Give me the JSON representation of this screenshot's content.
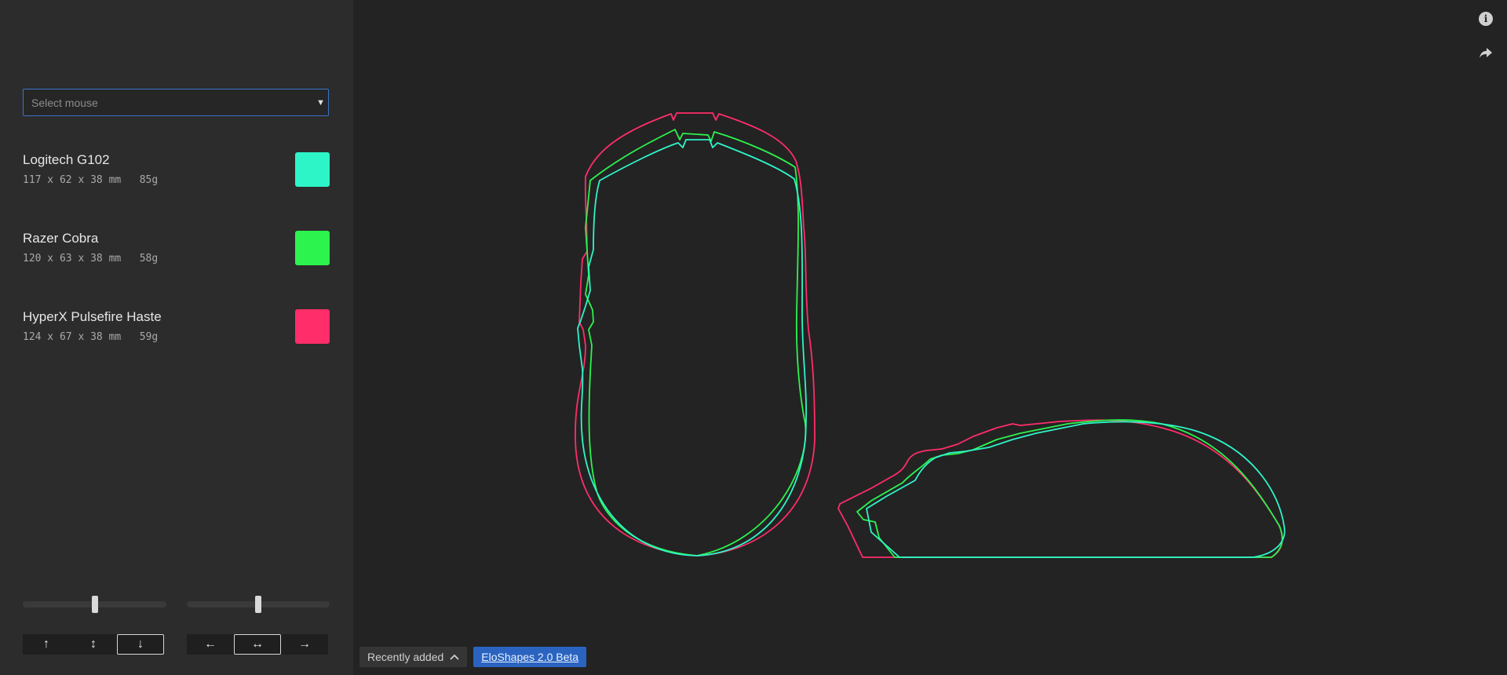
{
  "sidebar": {
    "select": {
      "placeholder": "Select mouse"
    },
    "mice": [
      {
        "name": "Logitech G102",
        "specs": "117 x 62 x 38 mm   85g",
        "color": "#2ef5c8"
      },
      {
        "name": "Razer Cobra",
        "specs": "120 x 63 x 38 mm   58g",
        "color": "#2cf34e"
      },
      {
        "name": "HyperX Pulsefire Haste",
        "specs": "124 x 67 x 38 mm   59g",
        "color": "#ff2d6a"
      }
    ],
    "vertical_alignment": {
      "slider_value": 0.5,
      "buttons": [
        {
          "icon": "arrow-up-icon",
          "glyph": "↑",
          "active": false
        },
        {
          "icon": "arrow-up-down-icon",
          "glyph": "↕",
          "active": false
        },
        {
          "icon": "arrow-down-icon",
          "glyph": "↓",
          "active": true
        }
      ]
    },
    "horizontal_alignment": {
      "slider_value": 0.5,
      "buttons": [
        {
          "icon": "arrow-left-icon",
          "glyph": "←",
          "active": false
        },
        {
          "icon": "arrow-left-right-icon",
          "glyph": "↔",
          "active": true
        },
        {
          "icon": "arrow-right-icon",
          "glyph": "→",
          "active": false
        }
      ]
    }
  },
  "bottom": {
    "recent_label": "Recently added",
    "recent_icon": "chevron-up-icon",
    "beta_link": "EloShapes 2.0 Beta"
  },
  "top_icons": {
    "info": "info-icon",
    "share": "share-icon"
  }
}
